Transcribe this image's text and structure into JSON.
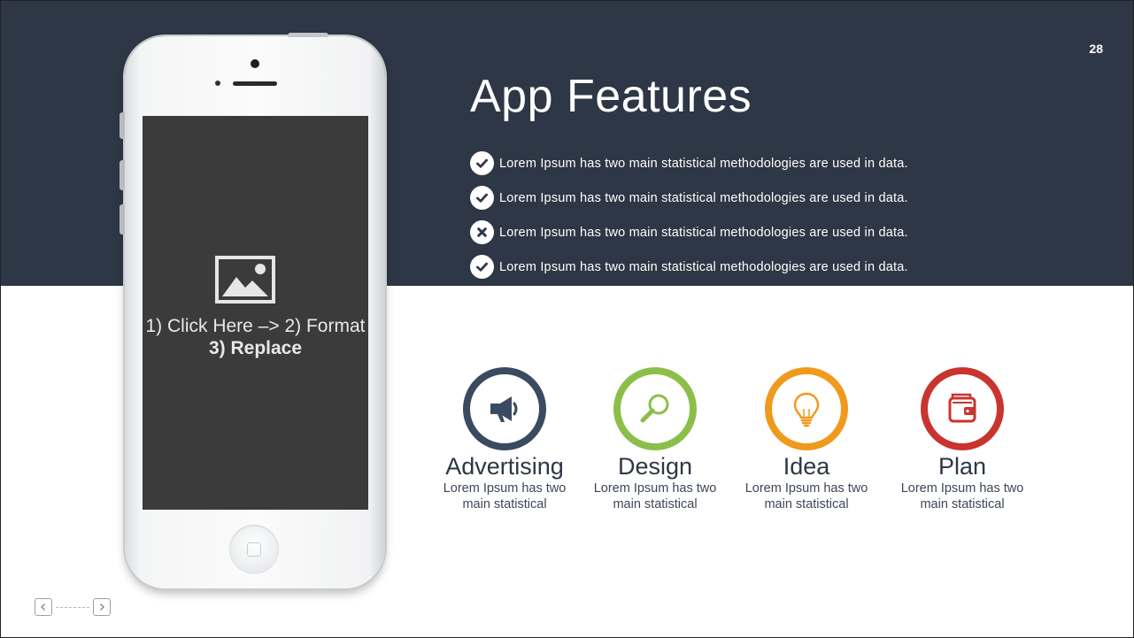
{
  "slide": {
    "page_number": "28",
    "title": "App Features"
  },
  "features": [
    {
      "icon": "check-circle-icon",
      "text": "Lorem Ipsum has two main statistical methodologies are used in data."
    },
    {
      "icon": "check-circle-icon",
      "text": "Lorem Ipsum has two main statistical methodologies are used in data."
    },
    {
      "icon": "x-circle-icon",
      "text": "Lorem Ipsum has two main statistical methodologies are used in data."
    },
    {
      "icon": "check-circle-icon",
      "text": "Lorem Ipsum has two main statistical methodologies are used in data."
    }
  ],
  "phone": {
    "placeholder_line1": "1) Click Here –> 2) Format",
    "placeholder_line2": "3) Replace",
    "placeholder_icon": "image-icon"
  },
  "categories": [
    {
      "title": "Advertising",
      "desc_line1": "Lorem Ipsum has two",
      "desc_line2": "main statistical",
      "icon": "megaphone-icon",
      "color": "#3a4a60"
    },
    {
      "title": "Design",
      "desc_line1": "Lorem Ipsum has two",
      "desc_line2": "main statistical",
      "icon": "magnifier-icon",
      "color": "#8cbf4a"
    },
    {
      "title": "Idea",
      "desc_line1": "Lorem Ipsum has two",
      "desc_line2": "main statistical",
      "icon": "lightbulb-icon",
      "color": "#f09a1d"
    },
    {
      "title": "Plan",
      "desc_line1": "Lorem Ipsum has two",
      "desc_line2": "main statistical",
      "icon": "wallet-icon",
      "color": "#c9342f"
    }
  ],
  "colors": {
    "header_band": "#2d3745",
    "screen": "#3b3b3b",
    "text_dark": "#2d3745"
  },
  "navigation": {
    "prev_icon": "chevron-left-icon",
    "next_icon": "chevron-right-icon"
  }
}
